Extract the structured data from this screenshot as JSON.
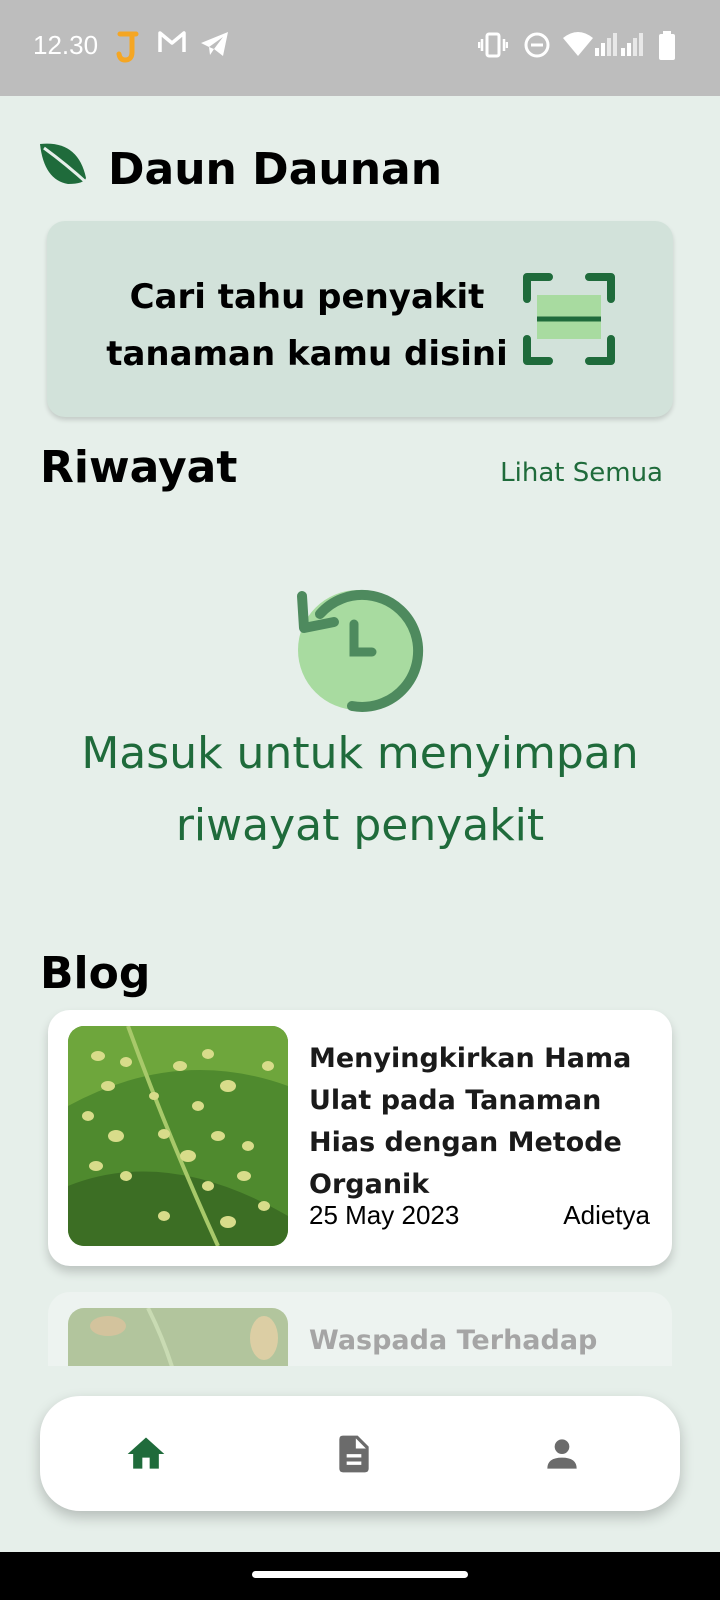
{
  "status_bar": {
    "time": "12.30",
    "left_icons": [
      "jago-app-icon",
      "gmail-icon",
      "telegram-icon"
    ],
    "right_icons": [
      "vibrate-icon",
      "do-not-disturb-icon",
      "wifi-icon",
      "signal-icon",
      "signal-icon",
      "battery-icon"
    ]
  },
  "header": {
    "title": "Daun Daunan",
    "logo_icon": "leaf-icon"
  },
  "scan_card": {
    "text": "Cari tahu penyakit tanaman kamu disini",
    "icon": "scan-icon"
  },
  "history": {
    "title": "Riwayat",
    "see_all": "Lihat Semua",
    "empty_icon": "history-icon",
    "empty_text": "Masuk untuk menyimpan riwayat penyakit"
  },
  "blog": {
    "title": "Blog",
    "posts": [
      {
        "title": "Menyingkirkan Hama Ulat pada Tanaman Hias dengan Metode Organik",
        "date": "25 May 2023",
        "author": "Adietya"
      },
      {
        "title": "Waspada Terhadap",
        "date": "",
        "author": ""
      }
    ]
  },
  "bottom_nav": {
    "items": [
      {
        "icon": "home-icon",
        "active": true
      },
      {
        "icon": "document-icon",
        "active": false
      },
      {
        "icon": "profile-icon",
        "active": false
      }
    ]
  },
  "colors": {
    "primary": "#1f6b3b",
    "background": "#e6efea",
    "card": "#d2e2da",
    "accent_light": "#a8dba0",
    "status_bar": "#bdbdbd",
    "inactive_icon": "#6b6b6b"
  }
}
